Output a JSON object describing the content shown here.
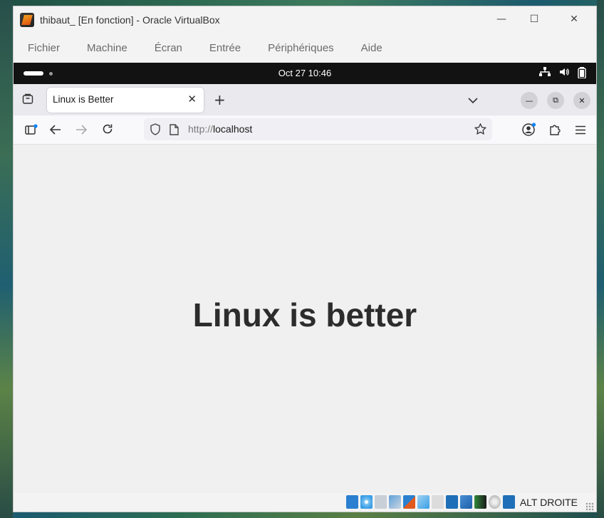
{
  "window": {
    "title": "thibaut_ [En fonction] - Oracle VirtualBox",
    "menu": [
      "Fichier",
      "Machine",
      "Écran",
      "Entrée",
      "Périphériques",
      "Aide"
    ]
  },
  "gnome": {
    "clock": "Oct 27  10:46"
  },
  "browser": {
    "tab_title": "Linux is Better",
    "url_scheme": "http://",
    "url_host": "localhost"
  },
  "page": {
    "heading": "Linux is better"
  },
  "statusbar": {
    "host_key_label": "ALT DROITE"
  },
  "colors": {
    "gnome_bar": "#121212",
    "page_bg": "#f0f0f0",
    "heading": "#2c2c2c"
  }
}
